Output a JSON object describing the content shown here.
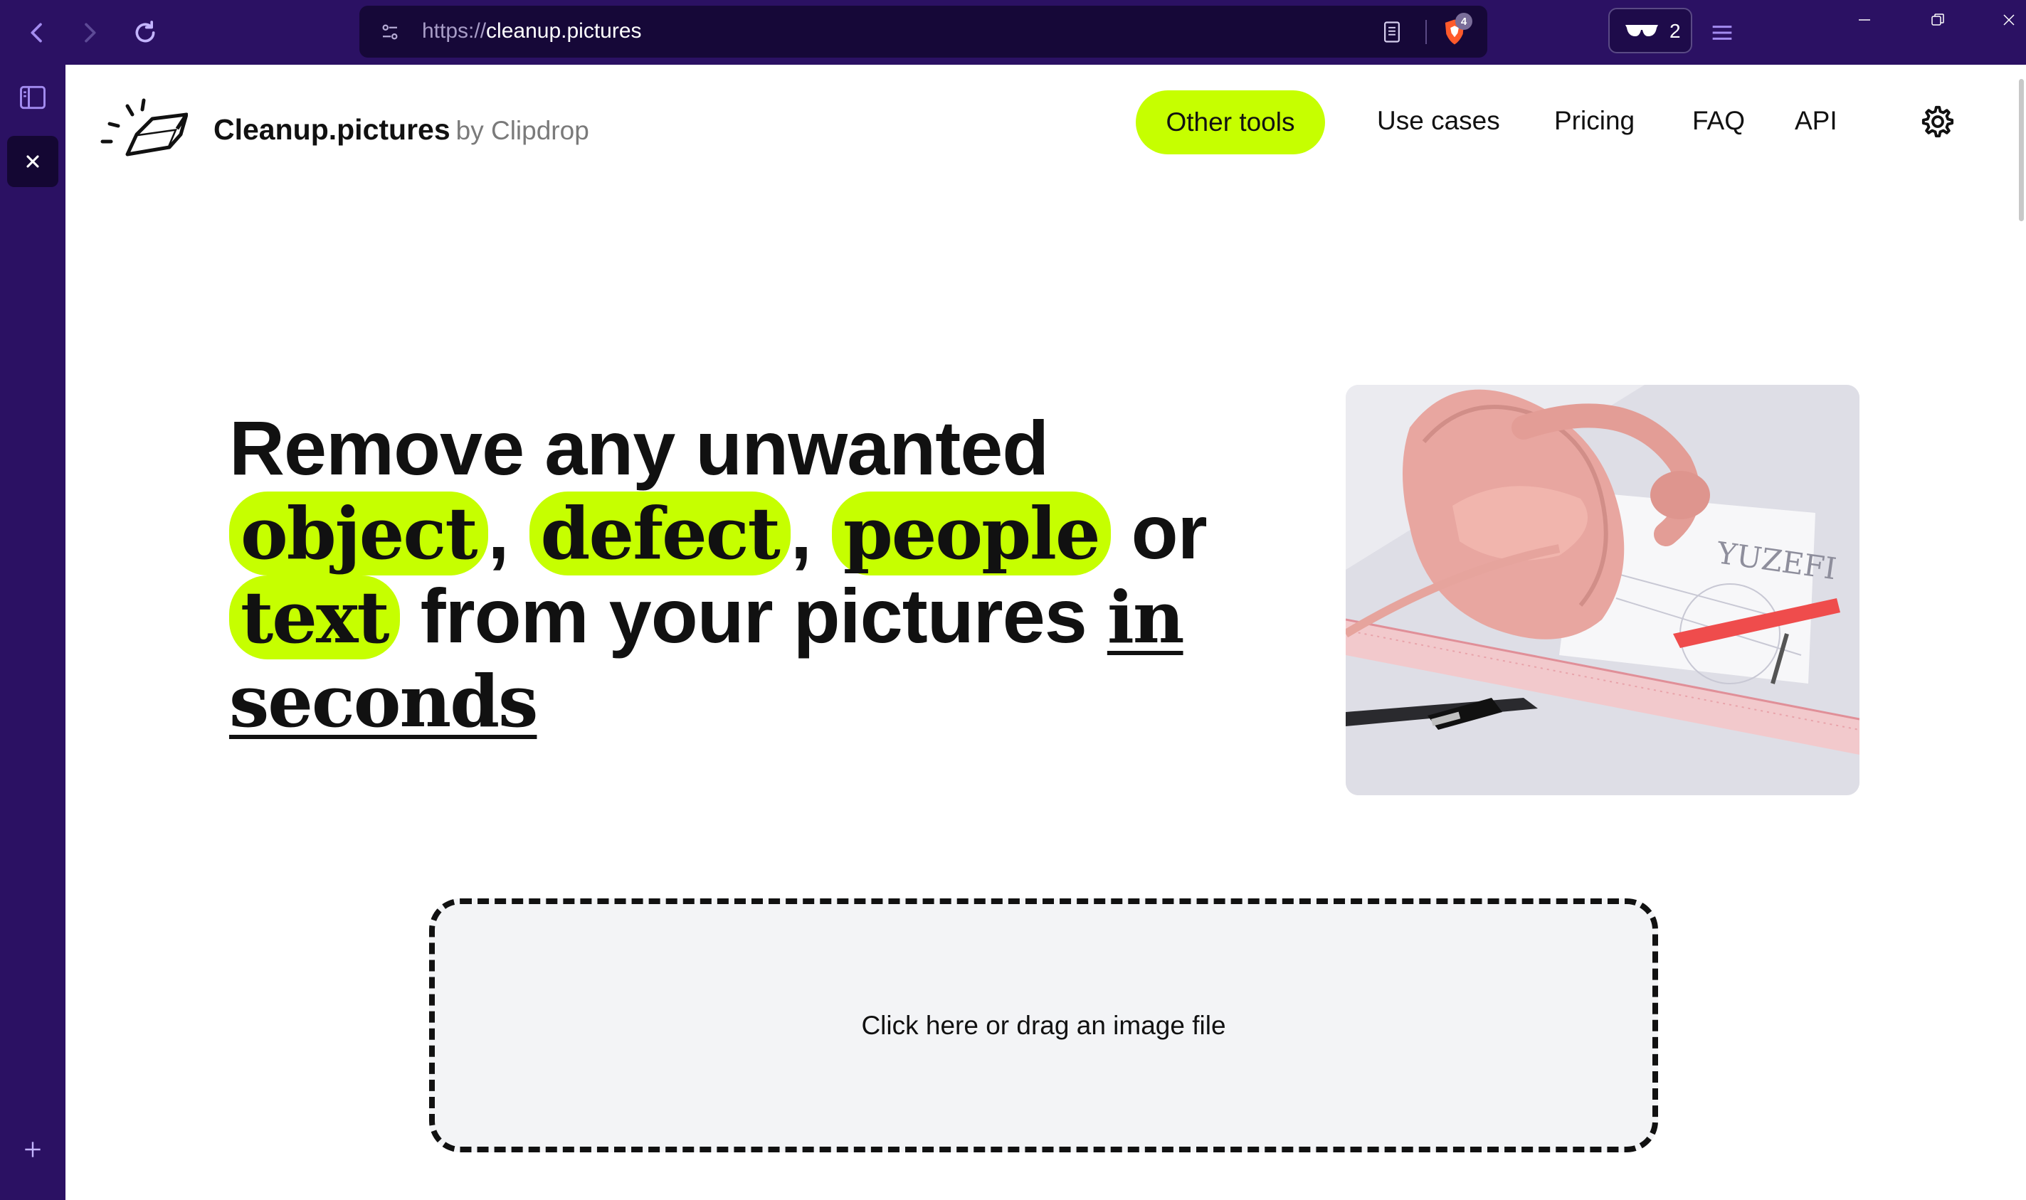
{
  "browser": {
    "url_scheme": "https://",
    "url_host": "cleanup.pictures",
    "shields_count": "4",
    "wallet_count": "2"
  },
  "site": {
    "brand_name": "Cleanup.pictures",
    "brand_by": "by Clipdrop",
    "nav": {
      "other_tools": "Other tools",
      "use_cases": "Use cases",
      "pricing": "Pricing",
      "faq": "FAQ",
      "api": "API"
    },
    "headline": {
      "line1": "Remove any unwanted",
      "object": "object",
      "comma1": ",",
      "defect": "defect",
      "comma2": ",",
      "people": "people",
      "or": "or",
      "text": "text",
      "from": "from your pictures",
      "in": "in",
      "seconds": "seconds"
    },
    "hero_image_text": "YUZEFI",
    "dropzone_label": "Click here or drag an image file"
  },
  "colors": {
    "accent": "#c6ff00",
    "chrome": "#2b1163",
    "urlbar": "#160838"
  }
}
